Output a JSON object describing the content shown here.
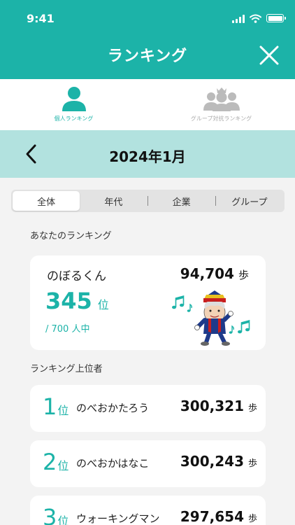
{
  "status_bar": {
    "time": "9:41"
  },
  "header": {
    "title": "ランキング"
  },
  "tabs": [
    {
      "label": "個人ランキング",
      "icon": "person-icon",
      "active": true
    },
    {
      "label": "グループ対抗ランキング",
      "icon": "group-icon",
      "active": false
    }
  ],
  "month": {
    "label": "2024年1月"
  },
  "segments": [
    {
      "label": "全体",
      "active": true
    },
    {
      "label": "年代",
      "active": false
    },
    {
      "label": "企業",
      "active": false
    },
    {
      "label": "グループ",
      "active": false
    }
  ],
  "my_ranking": {
    "section_title": "あなたのランキング",
    "name": "のぼるくん",
    "steps": "94,704",
    "steps_unit": "歩",
    "rank": "345",
    "rank_unit": "位",
    "total": "/ 700 人中"
  },
  "top_rankers": {
    "section_title": "ランキング上位者",
    "items": [
      {
        "rank": "1",
        "rank_unit": "位",
        "name": "のべおかたろう",
        "steps": "300,321",
        "steps_unit": "歩"
      },
      {
        "rank": "2",
        "rank_unit": "位",
        "name": "のべおかはなこ",
        "steps": "300,243",
        "steps_unit": "歩"
      },
      {
        "rank": "3",
        "rank_unit": "位",
        "name": "ウォーキングマン",
        "steps": "297,654",
        "steps_unit": "歩"
      }
    ]
  },
  "colors": {
    "primary": "#1cb3a8",
    "month_bar": "#b2e2df",
    "background": "#f3f3f3"
  }
}
